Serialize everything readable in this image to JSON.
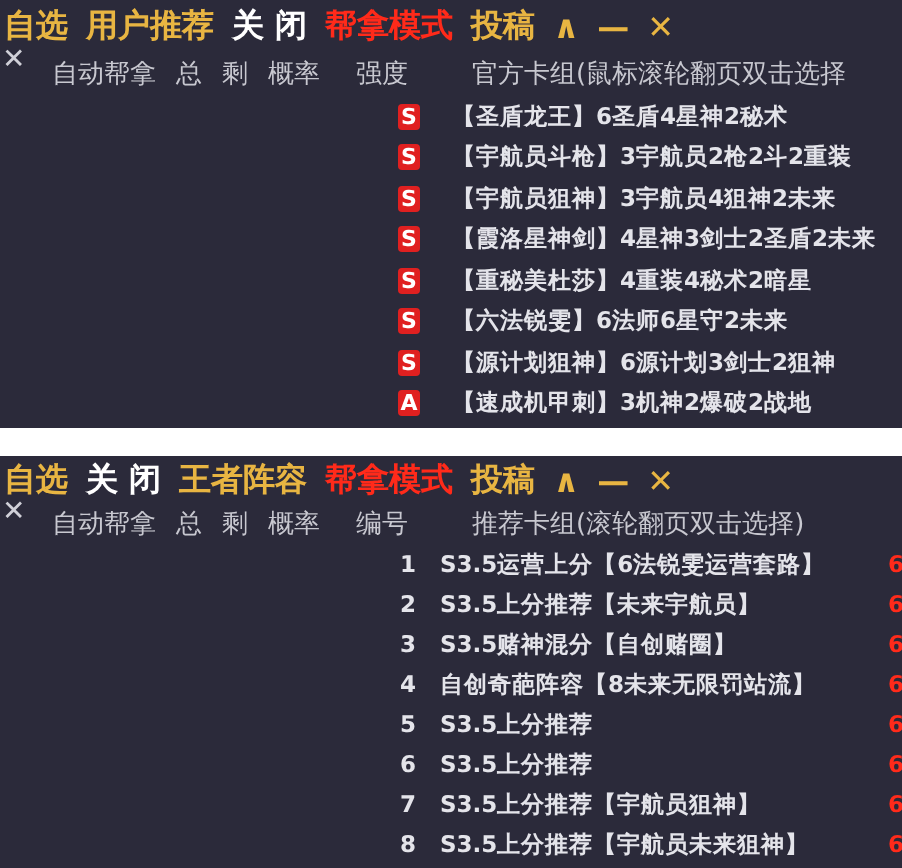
{
  "panels": [
    {
      "menu": [
        {
          "text": "自选",
          "kind": "gold"
        },
        {
          "text": "用户推荐",
          "kind": "gold"
        },
        {
          "text": "关 闭",
          "kind": "white"
        },
        {
          "text": "帮拿模式",
          "kind": "red"
        },
        {
          "text": "投稿",
          "kind": "gold"
        },
        {
          "text": "∧",
          "kind": "gold"
        },
        {
          "text": "—",
          "kind": "gold"
        },
        {
          "text": "✕",
          "kind": "gold"
        }
      ],
      "close": "✕",
      "headers": [
        "自动帮拿",
        "总",
        "剩",
        "概率",
        "强度",
        "官方卡组(鼠标滚轮翻页双击选择"
      ],
      "rows": [
        {
          "kind": "badge",
          "mark": "S",
          "text": "【圣盾龙王】6圣盾4星神2秘术"
        },
        {
          "kind": "badge",
          "mark": "S",
          "text": "【宇航员斗枪】3宇航员2枪2斗2重装"
        },
        {
          "kind": "badge",
          "mark": "S",
          "text": "【宇航员狙神】3宇航员4狙神2未来"
        },
        {
          "kind": "badge",
          "mark": "S",
          "text": "【霞洛星神剑】4星神3剑士2圣盾2未来"
        },
        {
          "kind": "badge",
          "mark": "S",
          "text": "【重秘美杜莎】4重装4秘术2暗星"
        },
        {
          "kind": "badge",
          "mark": "S",
          "text": "【六法锐雯】6法师6星守2未来"
        },
        {
          "kind": "badge",
          "mark": "S",
          "text": "【源计划狙神】6源计划3剑士2狙神"
        },
        {
          "kind": "badge",
          "mark": "A",
          "text": "【速成机甲刺】3机神2爆破2战地"
        }
      ]
    },
    {
      "menu": [
        {
          "text": "自选",
          "kind": "gold"
        },
        {
          "text": "关 闭",
          "kind": "white"
        },
        {
          "text": "王者阵容",
          "kind": "gold"
        },
        {
          "text": "帮拿模式",
          "kind": "red"
        },
        {
          "text": "投稿",
          "kind": "gold"
        },
        {
          "text": "∧",
          "kind": "gold"
        },
        {
          "text": "—",
          "kind": "gold"
        },
        {
          "text": "✕",
          "kind": "gold"
        }
      ],
      "close": "✕",
      "headers": [
        "自动帮拿",
        "总",
        "剩",
        "概率",
        "编号",
        "推荐卡组(滚轮翻页双击选择)"
      ],
      "rows": [
        {
          "kind": "index",
          "mark": "1",
          "text": "S3.5运营上分【6法锐雯运营套路】",
          "extra": "6"
        },
        {
          "kind": "index",
          "mark": "2",
          "text": "S3.5上分推荐【未来宇航员】",
          "extra": "6"
        },
        {
          "kind": "index",
          "mark": "3",
          "text": "S3.5赌神混分【自创赌圈】",
          "extra": "6"
        },
        {
          "kind": "index",
          "mark": "4",
          "text": "自创奇葩阵容【8未来无限罚站流】",
          "extra": "6"
        },
        {
          "kind": "index",
          "mark": "5",
          "text": "S3.5上分推荐",
          "extra": "6"
        },
        {
          "kind": "index",
          "mark": "6",
          "text": "S3.5上分推荐",
          "extra": "6"
        },
        {
          "kind": "index",
          "mark": "7",
          "text": "S3.5上分推荐【宇航员狙神】",
          "extra": "6"
        },
        {
          "kind": "index",
          "mark": "8",
          "text": "S3.5上分推荐【宇航员未来狙神】",
          "extra": "6"
        }
      ]
    }
  ]
}
